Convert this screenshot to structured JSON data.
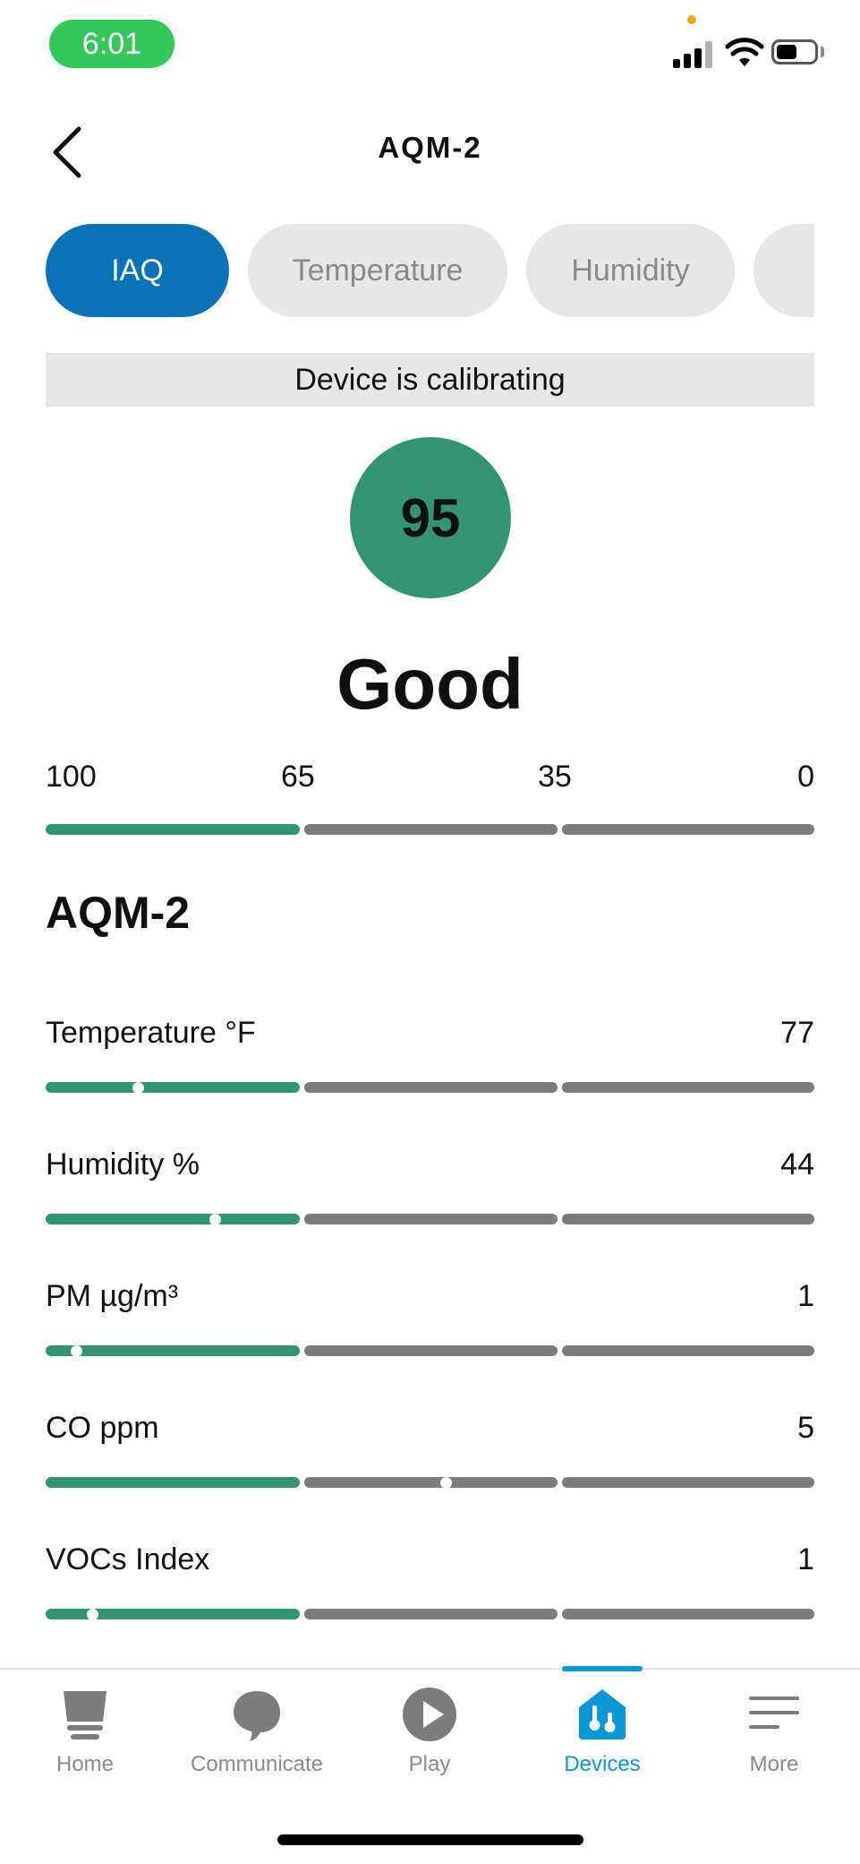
{
  "status_bar": {
    "time": "6:01"
  },
  "header": {
    "title": "AQM-2",
    "back_icon": "chevron-left-icon"
  },
  "tabs": [
    {
      "label": "IAQ",
      "active": true
    },
    {
      "label": "Temperature",
      "active": false
    },
    {
      "label": "Humidity",
      "active": false
    },
    {
      "label": "",
      "active": false
    }
  ],
  "calibration_banner": "Device is calibrating",
  "iaq": {
    "score": "95",
    "rating": "Good",
    "scale_labels": [
      "100",
      "65",
      "35",
      "0"
    ]
  },
  "device_section": {
    "title": "AQM-2",
    "metrics": [
      {
        "label": "Temperature °F",
        "value": "77",
        "marker_fraction": 0.12
      },
      {
        "label": "Humidity %",
        "value": "44",
        "marker_fraction": 0.22
      },
      {
        "label": "PM µg/m³",
        "value": "1",
        "marker_fraction": 0.04
      },
      {
        "label": "CO ppm",
        "value": "5",
        "marker_fraction": 0.52
      },
      {
        "label": "VOCs Index",
        "value": "1",
        "marker_fraction": 0.06
      }
    ]
  },
  "colors": {
    "accent_blue": "#0a73b7",
    "good_green": "#339474",
    "inactive_gray": "#7c7c7c",
    "nav_active": "#0a97d6"
  },
  "bottom_nav": [
    {
      "label": "Home",
      "icon": "home-icon",
      "active": false
    },
    {
      "label": "Communicate",
      "icon": "speech-bubble-icon",
      "active": false
    },
    {
      "label": "Play",
      "icon": "play-icon",
      "active": false
    },
    {
      "label": "Devices",
      "icon": "devices-house-icon",
      "active": true
    },
    {
      "label": "More",
      "icon": "menu-lines-icon",
      "active": false
    }
  ]
}
